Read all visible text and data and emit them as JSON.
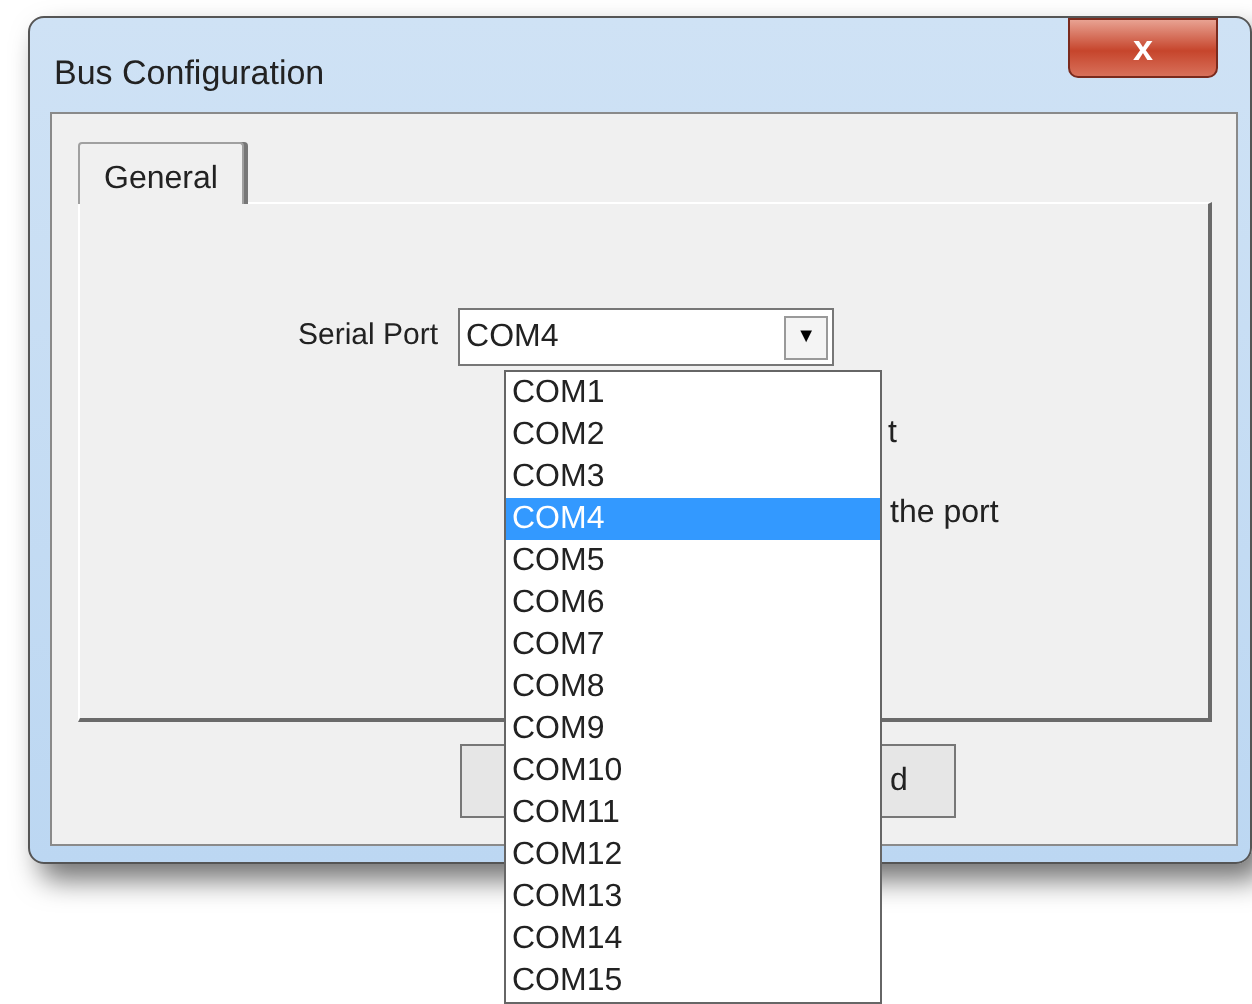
{
  "window": {
    "title": "Bus Configuration",
    "close": "x"
  },
  "tabs": [
    {
      "label": "General",
      "selected": true
    }
  ],
  "serial_port": {
    "label": "Serial Port",
    "value": "COM4",
    "arrow": "▼"
  },
  "hidden_texts": [
    "t",
    "the port",
    "d"
  ],
  "dropdown": [
    {
      "label": "COM1",
      "selected": false
    },
    {
      "label": "COM2",
      "selected": false
    },
    {
      "label": "COM3",
      "selected": false
    },
    {
      "label": "COM4",
      "selected": true
    },
    {
      "label": "COM5",
      "selected": false
    },
    {
      "label": "COM6",
      "selected": false
    },
    {
      "label": "COM7",
      "selected": false
    },
    {
      "label": "COM8",
      "selected": false
    },
    {
      "label": "COM9",
      "selected": false
    },
    {
      "label": "COM10",
      "selected": false
    },
    {
      "label": "COM11",
      "selected": false
    },
    {
      "label": "COM12",
      "selected": false
    },
    {
      "label": "COM13",
      "selected": false
    },
    {
      "label": "COM14",
      "selected": false
    },
    {
      "label": "COM15",
      "selected": false
    }
  ]
}
